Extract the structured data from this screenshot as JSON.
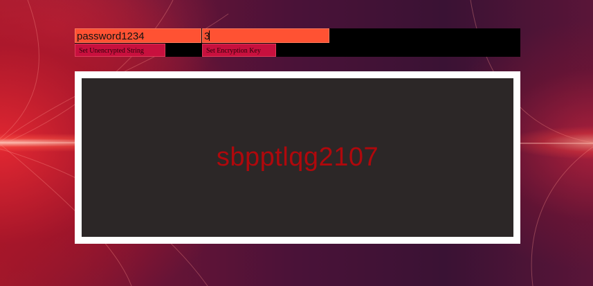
{
  "inputs": {
    "unencrypted_value": "password1234",
    "key_value": "3"
  },
  "buttons": {
    "set_unencrypted": "Set Unencrypted String",
    "set_key": "Set Encryption Key"
  },
  "output": {
    "encrypted_text": "sbpptlqg2107"
  },
  "colors": {
    "input_bg": "#ff5233",
    "button_bg": "#c8103e",
    "output_text": "#b0080c",
    "output_bg": "#2c2727"
  }
}
